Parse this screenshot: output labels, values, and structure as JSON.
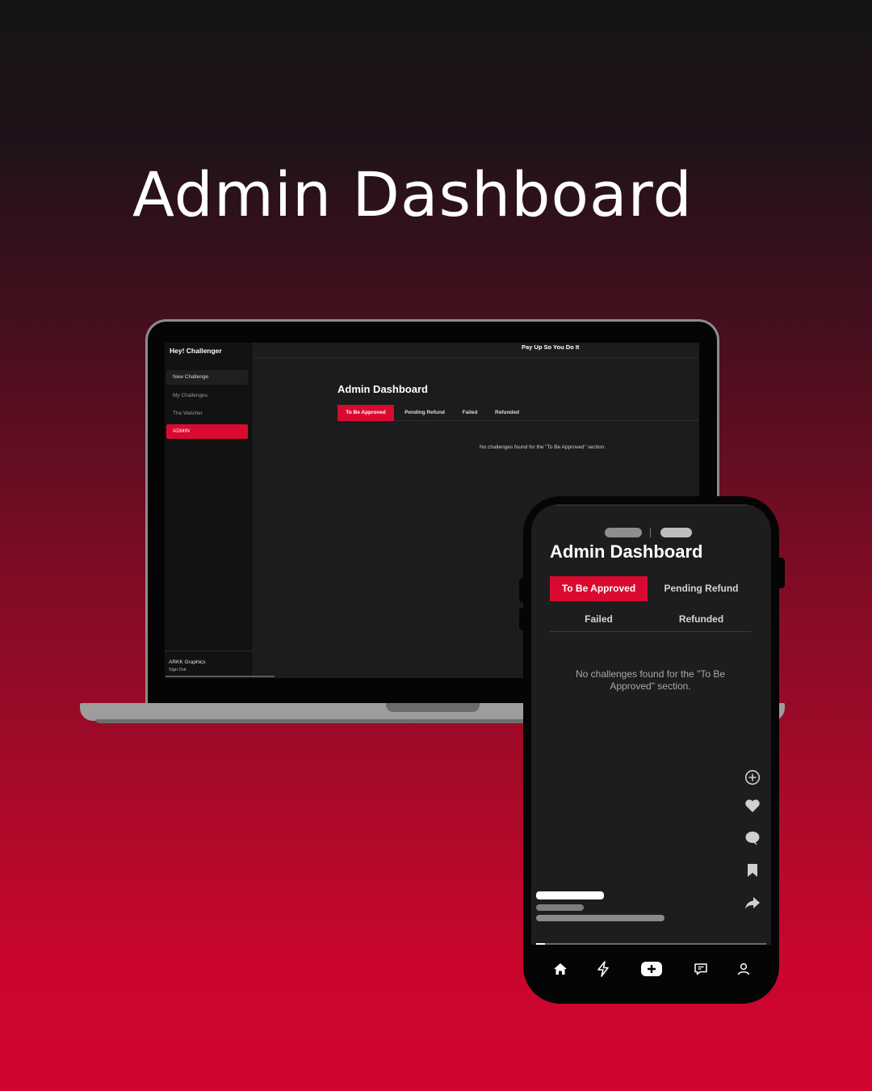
{
  "headline": "Admin Dashboard",
  "laptop": {
    "sidebar": {
      "brand": "Hey! Challenger",
      "items": [
        {
          "label": "New Challenge"
        },
        {
          "label": "My Challenges"
        },
        {
          "label": "The Watcher"
        },
        {
          "label": "ADMIN",
          "active": true
        }
      ],
      "footer": {
        "org": "ARKK Graphics",
        "signout": "Sign Out"
      }
    },
    "topbar": {
      "app_title": "Pay Up So You Do It"
    },
    "title": "Admin Dashboard",
    "tabs": [
      {
        "label": "To Be Approved",
        "active": true
      },
      {
        "label": "Pending Refund"
      },
      {
        "label": "Failed"
      },
      {
        "label": "Refunded"
      }
    ],
    "empty_message": "No challenges found for the \"To Be Approved\" section."
  },
  "phone": {
    "title": "Admin Dashboard",
    "tabs": [
      {
        "label": "To Be Approved",
        "active": true
      },
      {
        "label": "Pending Refund"
      },
      {
        "label": "Failed"
      },
      {
        "label": "Refunded"
      }
    ],
    "empty_message": "No challenges found for the \"To Be Approved\" section.",
    "right_actions": [
      "add-circle-icon",
      "heart-icon",
      "comment-icon",
      "bookmark-icon",
      "share-icon"
    ],
    "bottom_nav": [
      "home-icon",
      "lightning-icon",
      "create-plus-icon",
      "inbox-icon",
      "profile-icon"
    ],
    "video_progress": 0.04
  },
  "colors": {
    "accent": "#d90a30",
    "screen_bg": "#1c1c1e",
    "sidebar_bg": "#121213",
    "gradient_top": "#141416",
    "gradient_bottom": "#d1052f"
  }
}
